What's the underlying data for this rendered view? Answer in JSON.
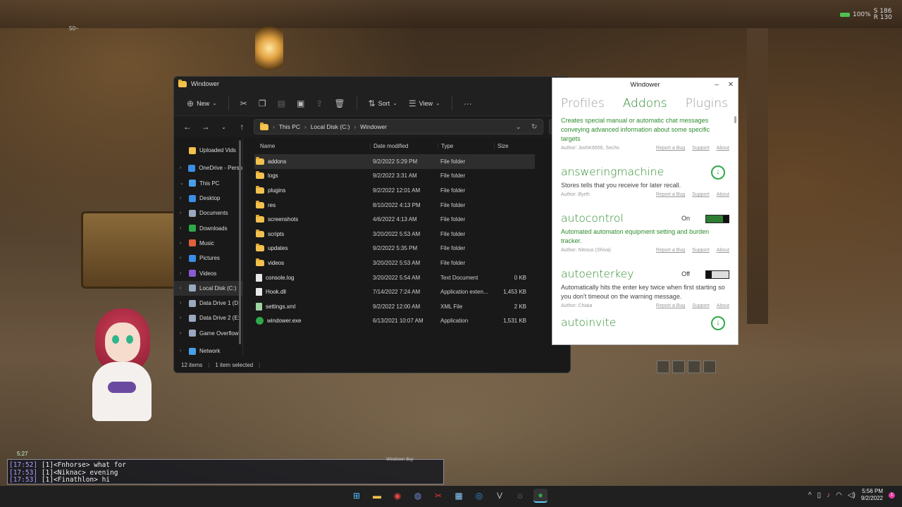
{
  "game_hud": {
    "status_pct": "100%",
    "coord_s": "S 186",
    "coord_r": "R 130",
    "level_tag": "50~",
    "compass_time": "5:27",
    "chat_title": "Windower Bay",
    "chat_lines": [
      {
        "ts": "[17:52]",
        "text": "[1]<Fnhorse> what for"
      },
      {
        "ts": "[17:53]",
        "text": "[1]<Niknac> evening"
      },
      {
        "ts": "[17:53]",
        "text": "[1]<Finathlon> hi"
      }
    ]
  },
  "explorer": {
    "title": "Windower",
    "toolbar": {
      "new_label": "New",
      "sort_label": "Sort",
      "view_label": "View",
      "more_label": "···"
    },
    "breadcrumb": [
      "This PC",
      "Local Disk (C:)",
      "Windower"
    ],
    "nav_items": [
      {
        "label": "Uploaded Vids",
        "arrow": "",
        "color": "#f2c14e",
        "selected": false
      },
      {
        "label": "OneDrive - Perso",
        "arrow": "›",
        "color": "#3a8ee6",
        "selected": false
      },
      {
        "label": "This PC",
        "arrow": "⌄",
        "color": "#4aa0e8",
        "selected": false
      },
      {
        "label": "Desktop",
        "arrow": "›",
        "color": "#3a8ee6",
        "selected": false
      },
      {
        "label": "Documents",
        "arrow": "›",
        "color": "#9aa8c0",
        "selected": false
      },
      {
        "label": "Downloads",
        "arrow": "›",
        "color": "#2ea84a",
        "selected": false
      },
      {
        "label": "Music",
        "arrow": "›",
        "color": "#e0603a",
        "selected": false
      },
      {
        "label": "Pictures",
        "arrow": "›",
        "color": "#3a8ee6",
        "selected": false
      },
      {
        "label": "Videos",
        "arrow": "›",
        "color": "#8a5ad0",
        "selected": false
      },
      {
        "label": "Local Disk (C:)",
        "arrow": "›",
        "color": "#9aa8c0",
        "selected": true
      },
      {
        "label": "Data Drive 1 (D:",
        "arrow": "›",
        "color": "#9aa8c0",
        "selected": false
      },
      {
        "label": "Data Drive 2 (E:",
        "arrow": "›",
        "color": "#9aa8c0",
        "selected": false
      },
      {
        "label": "Game Overflow",
        "arrow": "›",
        "color": "#9aa8c0",
        "selected": false
      },
      {
        "label": "Network",
        "arrow": "›",
        "color": "#4aa0e8",
        "selected": false
      }
    ],
    "columns": {
      "name": "Name",
      "date": "Date modified",
      "type": "Type",
      "size": "Size"
    },
    "files": [
      {
        "name": "addons",
        "date": "9/2/2022 5:29 PM",
        "type": "File folder",
        "size": "",
        "icon": "folder",
        "selected": true
      },
      {
        "name": "logs",
        "date": "9/2/2022 3:31 AM",
        "type": "File folder",
        "size": "",
        "icon": "folder",
        "selected": false
      },
      {
        "name": "plugins",
        "date": "9/2/2022 12:01 AM",
        "type": "File folder",
        "size": "",
        "icon": "folder",
        "selected": false
      },
      {
        "name": "res",
        "date": "8/10/2022 4:13 PM",
        "type": "File folder",
        "size": "",
        "icon": "folder",
        "selected": false
      },
      {
        "name": "screenshots",
        "date": "4/6/2022 4:13 AM",
        "type": "File folder",
        "size": "",
        "icon": "folder",
        "selected": false
      },
      {
        "name": "scripts",
        "date": "3/20/2022 5:53 AM",
        "type": "File folder",
        "size": "",
        "icon": "folder",
        "selected": false
      },
      {
        "name": "updates",
        "date": "9/2/2022 5:35 PM",
        "type": "File folder",
        "size": "",
        "icon": "folder",
        "selected": false
      },
      {
        "name": "videos",
        "date": "3/20/2022 5:53 AM",
        "type": "File folder",
        "size": "",
        "icon": "folder",
        "selected": false
      },
      {
        "name": "console.log",
        "date": "3/20/2022 5:54 AM",
        "type": "Text Document",
        "size": "0 KB",
        "icon": "doc",
        "selected": false
      },
      {
        "name": "Hook.dll",
        "date": "7/14/2022 7:24 AM",
        "type": "Application exten...",
        "size": "1,453 KB",
        "icon": "doc",
        "selected": false
      },
      {
        "name": "settings.xml",
        "date": "9/2/2022 12:00 AM",
        "type": "XML File",
        "size": "2 KB",
        "icon": "xml",
        "selected": false
      },
      {
        "name": "windower.exe",
        "date": "6/13/2021 10:07 AM",
        "type": "Application",
        "size": "1,531 KB",
        "icon": "exe",
        "selected": false
      }
    ],
    "status": {
      "count": "12 items",
      "selected": "1 item selected"
    }
  },
  "launcher": {
    "title": "Windower",
    "tabs": [
      {
        "label": "Profiles",
        "active": false
      },
      {
        "label": "Addons",
        "active": true
      },
      {
        "label": "Plugins",
        "active": false
      }
    ],
    "top_desc": "Creates special manual or automatic chat messages conveying advanced information about some specific targets",
    "top_author": "Author: JoshK6656, Sechs",
    "link_report": "Report a Bug",
    "link_support": "Support",
    "link_about": "About",
    "addons": [
      {
        "name": "answeringmachine",
        "desc": "Stores tells that you receive for later recall.",
        "author": "Author: Byrth",
        "state": "download",
        "state_label": ""
      },
      {
        "name": "autocontrol",
        "desc": "Automated automaton equipment setting and burden tracker.",
        "author": "Author: Nitrous (Shiva)",
        "state": "on",
        "state_label": "On"
      },
      {
        "name": "autoenterkey",
        "desc": "Automatically hits the enter key twice when first starting so you don't timeout on the warning message.",
        "author": "Author: Chiaia",
        "state": "off",
        "state_label": "Off"
      }
    ],
    "last_addon": "autoinvite"
  },
  "taskbar": {
    "apps": [
      "windows-start",
      "file-explorer",
      "chrome",
      "discord",
      "snipping-tool",
      "photos",
      "browser",
      "vs-code",
      "obs",
      "windower"
    ],
    "time": "5:56 PM",
    "date": "9/2/2022",
    "notifications": "1"
  }
}
